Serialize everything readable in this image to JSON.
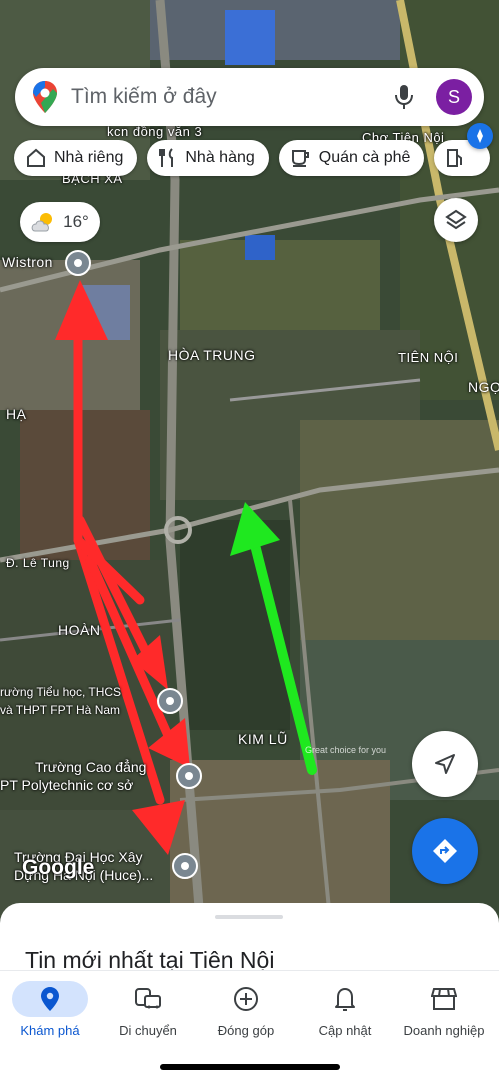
{
  "search": {
    "placeholder": "Tìm kiếm ở đây",
    "avatar_letter": "S"
  },
  "chips": [
    {
      "label": "Nhà riêng",
      "icon": "home-icon"
    },
    {
      "label": "Nhà hàng",
      "icon": "restaurant-icon"
    },
    {
      "label": "Quán cà phê",
      "icon": "coffee-icon"
    }
  ],
  "weather": {
    "temp": "16°",
    "icon": "partly-cloudy-icon"
  },
  "map": {
    "places": {
      "kcn": "kcn đồng văn 3",
      "cho": "Chợ Tiên Nội",
      "bach_xa": "BẠCH XA",
      "wistron": "Wistron",
      "hoa_trung": "HÒA TRUNG",
      "tien_noi": "TIÊN NỘI",
      "ngoc": "NGỌ",
      "ha": "HẠ",
      "le_tung": "Đ. Lê Tung",
      "hoan": "HOÀN",
      "kim_lu": "KIM LŨ"
    },
    "pois": {
      "school1_line1": "rường Tiểu học, THCS",
      "school1_line2": "và THPT FPT Hà Nam",
      "college_line1": "Trường Cao đẳng",
      "college_line2": "PT Polytechnic cơ sở",
      "univ_line1": "Trường Đại Học Xây",
      "univ_line2": "Dựng Hà Nội (Huce)..."
    },
    "google_logo": "Google",
    "watermark": "Great choice for you",
    "arrow_colors": {
      "red": "#ff2a2a",
      "green": "#1fe81f"
    }
  },
  "sheet": {
    "title": "Tin mới nhất tại Tiên Nội"
  },
  "nav": [
    {
      "label": "Khám phá",
      "icon": "explore-pin-icon",
      "active": true
    },
    {
      "label": "Di chuyển",
      "icon": "commute-icon",
      "active": false
    },
    {
      "label": "Đóng góp",
      "icon": "add-circle-icon",
      "active": false
    },
    {
      "label": "Cập nhật",
      "icon": "bell-icon",
      "active": false
    },
    {
      "label": "Doanh nghiệp",
      "icon": "store-icon",
      "active": false
    }
  ]
}
